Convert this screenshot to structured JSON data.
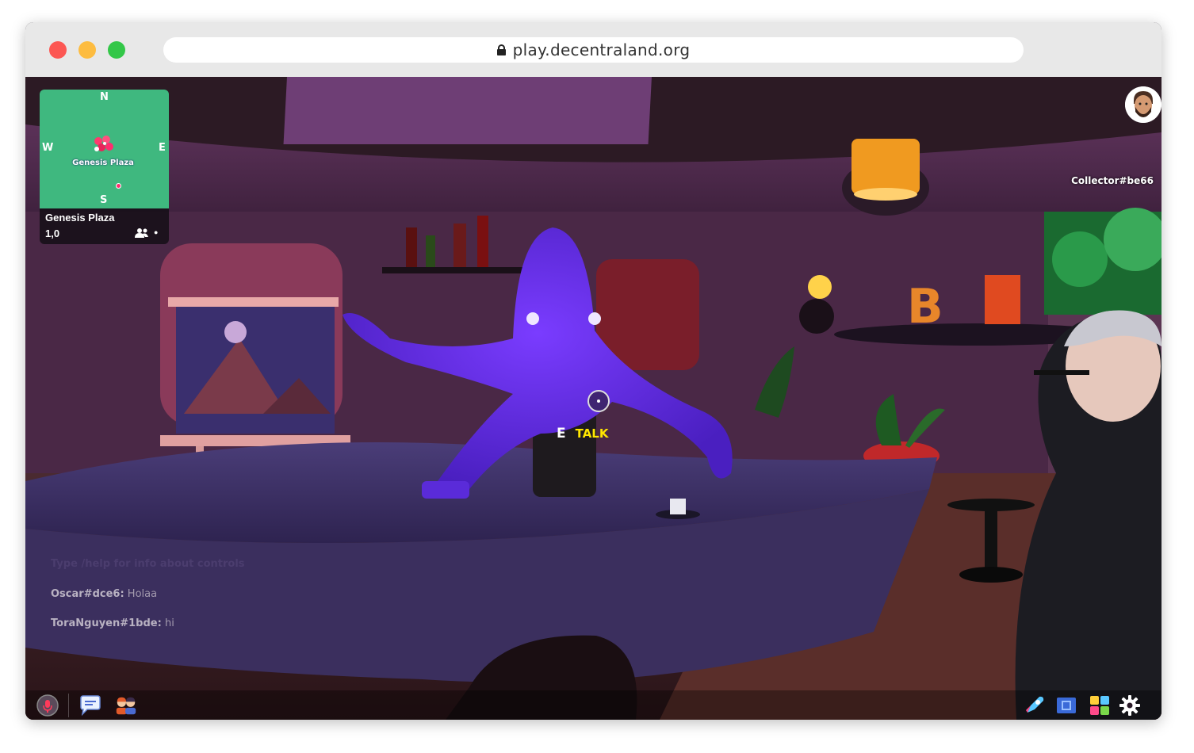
{
  "browser": {
    "url": "play.decentraland.org"
  },
  "minimap": {
    "compass": {
      "n": "N",
      "s": "S",
      "w": "W",
      "e": "E"
    },
    "map_label": "Genesis Plaza",
    "location_name": "Genesis Plaza",
    "coordinates": "1,0"
  },
  "interaction": {
    "key": "E",
    "action": "TALK"
  },
  "players": {
    "nameplate": "Collector#be66"
  },
  "chat": {
    "hint": "Type /help for info about controls",
    "messages": [
      {
        "user": "Oscar#dce6:",
        "text": "Holaa"
      },
      {
        "user": "ToraNguyen#1bde:",
        "text": "hi"
      }
    ]
  },
  "toolbar": {
    "left": [
      "microphone-icon",
      "chat-icon",
      "friends-icon"
    ],
    "right": [
      "explore-icon",
      "builder-icon",
      "backpack-icon",
      "settings-icon"
    ]
  },
  "colors": {
    "minimap_green": "#3fb87f",
    "talk_yellow": "#ffe600",
    "octopus": "#5b2bd9"
  }
}
